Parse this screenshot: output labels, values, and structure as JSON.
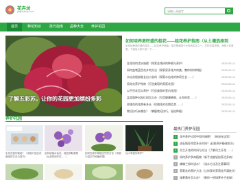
{
  "header": {
    "brand": "花卉坊",
    "url": "jinghuacao.com",
    "search_placeholder": "请输入关键字"
  },
  "nav": {
    "items": [
      {
        "label": "首页",
        "active": true
      },
      {
        "label": "种花知识",
        "active": false
      },
      {
        "label": "技巧指南",
        "active": false
      },
      {
        "label": "品种大全",
        "active": false
      },
      {
        "label": "养护花园",
        "active": false
      }
    ]
  },
  "hero": {
    "caption": "了解五彩苏，让你的花园更加缤纷多彩"
  },
  "featured": {
    "title": "如何培养更旺盛的桂花——桂花养护指南（从土壤选择到",
    "desc": "如何培养更旺盛的桂花——桂花养护指南。桂花是我国十大传统名花之一，它的花香浓郁，深受人们喜爱。下面给大家介绍一下……"
  },
  "news": [
    {
      "title": "金花如何浇水施肥（探索金钱树的种植与养护）",
      "date": "2025-05-11"
    },
    {
      "title": "如何盆栽蓝色花卉的方法（探索家养花卉的美，教你如何种植）",
      "date": "2025-05-11"
    },
    {
      "title": "水仙花根部能长出小苗吗（探索水仙花的神奇生长……）",
      "date": "2025-05-11"
    },
    {
      "title": "用花花养护指南（打造美丽的家庭花园）",
      "date": "2025-05-11"
    },
    {
      "title": "以不归花怎么养护（打造美丽的室内花园）",
      "date": "2025-05-11"
    },
    {
      "title": "盆里面种出现红斑怎么办（打造健康植物，让你的家……）",
      "date": "2025-05-11"
    },
    {
      "title": "玫瑰花的花期有多长（玫瑰花的花期及其……）",
      "date": "2025-05-11"
    },
    {
      "title": "栽培技巧有哪些？（掌握栽培技巧，轻松种植）",
      "date": "2025-05-11"
    }
  ],
  "section": {
    "title": "养护花园"
  },
  "cards": [
    {
      "caption": "生花花如何栽培？（详细介绍生花栽培的方法与技巧）"
    },
    {
      "caption": "如何培植水仙花，轻松获取美丽（从选球到开花……）"
    },
    {
      "caption": "如何在家中种植文竹的方法（详细介绍文竹种植步骤）"
    },
    {
      "caption": "仙人掌如何养护？"
    }
  ],
  "sidebar": {
    "title": "最热门养护花园",
    "items": [
      {
        "num": "1",
        "title": "花卉养护过程中如何施肥？（秘诀在这里）"
      },
      {
        "num": "2",
        "title": "油石斛寿命是多长时间？(石斛养护基础知识)"
      },
      {
        "num": "3",
        "title": "吊兰开花的时间与方法（了解吊兰开花……）"
      },
      {
        "num": "4",
        "title": "如何养护多肉植物（新手也能轻松养活多肉）"
      },
      {
        "num": "5",
        "title": "蝴蝶兰如何浇水？（浇水方法及注意事项）"
      },
      {
        "num": "6",
        "title": "茉莉花的养护方法（让你家的茉莉花开满枝头）"
      },
      {
        "num": "7",
        "title": "绿萝黄叶怎么办？（教你一招绿萝叶子变绿）"
      },
      {
        "num": "8",
        "title": "栀子花的养护技巧（栀子花……）"
      }
    ]
  }
}
